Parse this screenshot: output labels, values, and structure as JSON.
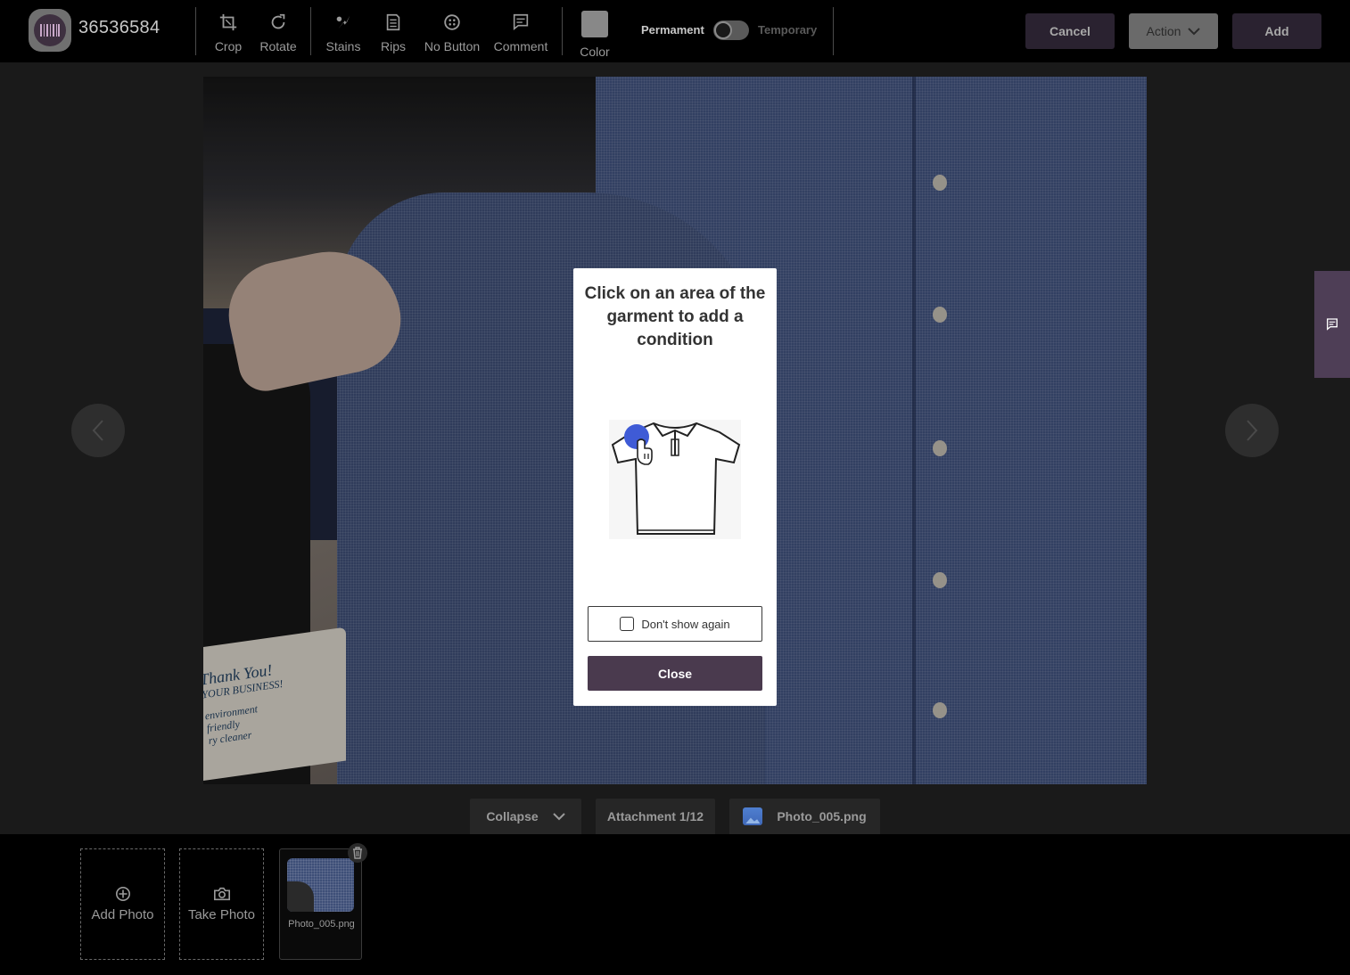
{
  "header": {
    "ticket_number": "36536584",
    "tools": [
      {
        "label": "Crop",
        "icon": "crop-icon"
      },
      {
        "label": "Rotate",
        "icon": "rotate-icon"
      },
      {
        "label": "Stains",
        "icon": "stain-icon"
      },
      {
        "label": "Rips",
        "icon": "rip-icon"
      },
      {
        "label": "No Button",
        "icon": "no-button-icon"
      },
      {
        "label": "Comment",
        "icon": "comment-icon"
      },
      {
        "label": "Color",
        "icon": "color-swatch"
      }
    ],
    "toggle": {
      "left_label": "Permament",
      "right_label": "Temporary",
      "state": "Permament"
    },
    "buttons": {
      "cancel": "Cancel",
      "action": "Action",
      "add": "Add"
    }
  },
  "modal": {
    "title": "Click on an area of the garment to add a condition",
    "checkbox_label": "Don't show again",
    "checkbox_checked": false,
    "close_label": "Close"
  },
  "attachment_tabs": {
    "collapse": "Collapse",
    "counter": "Attachment 1/12",
    "filename": "Photo_005.png"
  },
  "photo_placard": {
    "line1": "Thank You!",
    "line2": "YOUR BUSINESS!",
    "line3": "environment",
    "line4": "friendly",
    "line5": "ry cleaner"
  },
  "bottom_strip": {
    "add_photo": "Add Photo",
    "take_photo": "Take Photo",
    "thumbnail_label": "Photo_005.png"
  },
  "colors": {
    "accent": "#4a3a4e",
    "side_tab": "#4e3e56",
    "color_swatch": "#888888",
    "hint_dot": "#3f5bd6"
  }
}
